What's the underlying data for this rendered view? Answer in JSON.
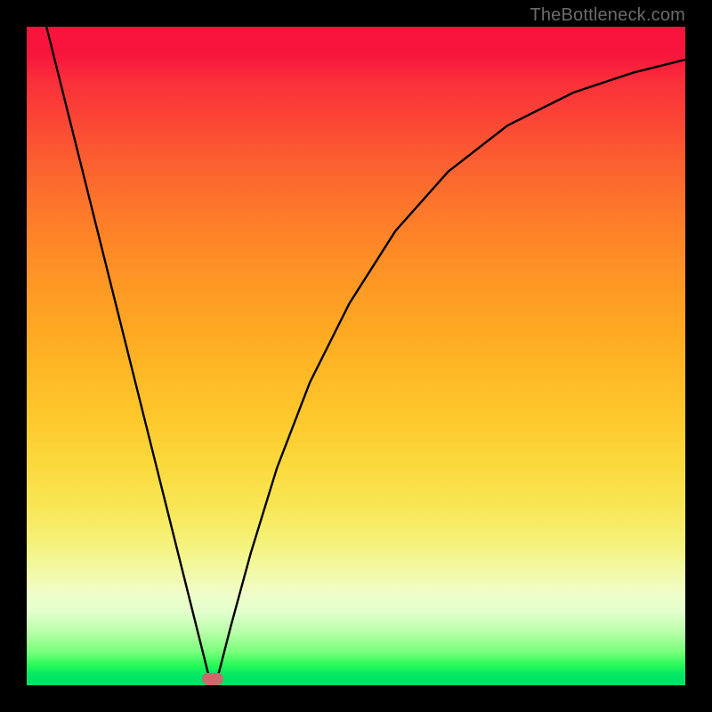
{
  "watermark": "TheBottleneck.com",
  "chart_data": {
    "type": "line",
    "title": "",
    "xlabel": "",
    "ylabel": "",
    "xlim": [
      0,
      1
    ],
    "ylim": [
      0,
      1
    ],
    "grid": false,
    "background": "red-to-green vertical gradient",
    "series": [
      {
        "name": "curve",
        "points": [
          {
            "x": 0.03,
            "y": 1.0
          },
          {
            "x": 0.06,
            "y": 0.88
          },
          {
            "x": 0.09,
            "y": 0.76
          },
          {
            "x": 0.12,
            "y": 0.64
          },
          {
            "x": 0.15,
            "y": 0.52
          },
          {
            "x": 0.18,
            "y": 0.4
          },
          {
            "x": 0.21,
            "y": 0.28
          },
          {
            "x": 0.24,
            "y": 0.16
          },
          {
            "x": 0.26,
            "y": 0.08
          },
          {
            "x": 0.275,
            "y": 0.02
          },
          {
            "x": 0.283,
            "y": 0.005
          },
          {
            "x": 0.292,
            "y": 0.02
          },
          {
            "x": 0.31,
            "y": 0.09
          },
          {
            "x": 0.34,
            "y": 0.2
          },
          {
            "x": 0.38,
            "y": 0.33
          },
          {
            "x": 0.43,
            "y": 0.46
          },
          {
            "x": 0.49,
            "y": 0.58
          },
          {
            "x": 0.56,
            "y": 0.69
          },
          {
            "x": 0.64,
            "y": 0.78
          },
          {
            "x": 0.73,
            "y": 0.85
          },
          {
            "x": 0.83,
            "y": 0.9
          },
          {
            "x": 0.92,
            "y": 0.93
          },
          {
            "x": 1.0,
            "y": 0.95
          }
        ]
      }
    ],
    "marker": {
      "x": 0.283,
      "y": 0.01,
      "color": "#c96b6a"
    }
  }
}
